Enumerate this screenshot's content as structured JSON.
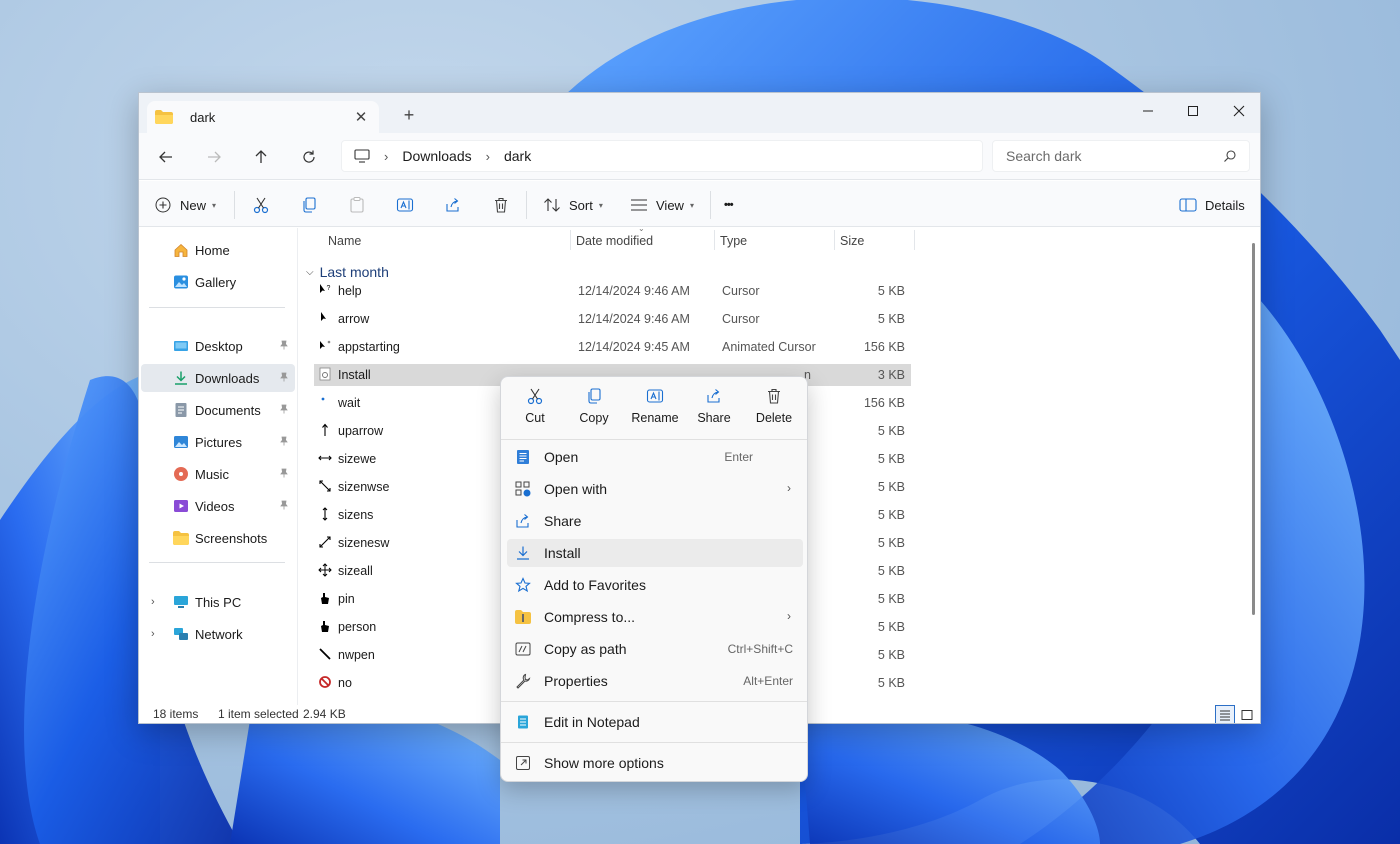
{
  "tab": {
    "title": "dark",
    "close_glyph": "✕",
    "new_tab_glyph": "+"
  },
  "window_controls": {
    "minimize": "—",
    "maximize": "☐",
    "close": "✕"
  },
  "address": {
    "segments": [
      "Downloads",
      "dark"
    ],
    "separator": "›"
  },
  "search": {
    "placeholder": "Search dark"
  },
  "toolbar": {
    "new_label": "New",
    "sort_label": "Sort",
    "view_label": "View",
    "more_glyph": "•••",
    "details_label": "Details",
    "caret": "▾"
  },
  "sidebar": {
    "top": [
      {
        "label": "Home",
        "icon": "home-icon"
      },
      {
        "label": "Gallery",
        "icon": "gallery-icon"
      }
    ],
    "pinned": [
      {
        "label": "Desktop",
        "icon": "desktop-icon",
        "pinned": true
      },
      {
        "label": "Downloads",
        "icon": "downloads-icon",
        "pinned": true,
        "selected": true
      },
      {
        "label": "Documents",
        "icon": "documents-icon",
        "pinned": true
      },
      {
        "label": "Pictures",
        "icon": "pictures-icon",
        "pinned": true
      },
      {
        "label": "Music",
        "icon": "music-icon",
        "pinned": true
      },
      {
        "label": "Videos",
        "icon": "videos-icon",
        "pinned": true
      },
      {
        "label": "Screenshots",
        "icon": "folder-icon",
        "pinned": false
      }
    ],
    "devices": [
      {
        "label": "This PC",
        "icon": "this-pc-icon"
      },
      {
        "label": "Network",
        "icon": "network-icon"
      }
    ],
    "expand_glyph": "›"
  },
  "columns": {
    "name": "Name",
    "date": "Date modified",
    "type": "Type",
    "size": "Size",
    "sort_glyph": "⌄"
  },
  "group": {
    "label": "Last month",
    "chevron": "⌵"
  },
  "files": [
    {
      "name": "help",
      "date": "12/14/2024 9:46 AM",
      "type": "Cursor",
      "size": "5 KB"
    },
    {
      "name": "arrow",
      "date": "12/14/2024 9:46 AM",
      "type": "Cursor",
      "size": "5 KB"
    },
    {
      "name": "appstarting",
      "date": "12/14/2024 9:45 AM",
      "type": "Animated Cursor",
      "size": "156 KB"
    },
    {
      "name": "Install",
      "date": "",
      "type": "n",
      "size": "3 KB",
      "selected": true
    },
    {
      "name": "wait",
      "date": "",
      "type": "r",
      "size": "156 KB"
    },
    {
      "name": "uparrow",
      "date": "",
      "type": "",
      "size": "5 KB"
    },
    {
      "name": "sizewe",
      "date": "",
      "type": "",
      "size": "5 KB"
    },
    {
      "name": "sizenwse",
      "date": "",
      "type": "",
      "size": "5 KB"
    },
    {
      "name": "sizens",
      "date": "",
      "type": "",
      "size": "5 KB"
    },
    {
      "name": "sizenesw",
      "date": "",
      "type": "",
      "size": "5 KB"
    },
    {
      "name": "sizeall",
      "date": "",
      "type": "",
      "size": "5 KB"
    },
    {
      "name": "pin",
      "date": "",
      "type": "",
      "size": "5 KB"
    },
    {
      "name": "person",
      "date": "",
      "type": "",
      "size": "5 KB"
    },
    {
      "name": "nwpen",
      "date": "",
      "type": "",
      "size": "5 KB"
    },
    {
      "name": "no",
      "date": "",
      "type": "",
      "size": "5 KB"
    }
  ],
  "status": {
    "items": "18 items",
    "selected": "1 item selected",
    "size": "2.94 KB"
  },
  "context_menu": {
    "quick_actions": [
      {
        "label": "Cut",
        "icon": "cut-icon"
      },
      {
        "label": "Copy",
        "icon": "copy-icon"
      },
      {
        "label": "Rename",
        "icon": "rename-icon"
      },
      {
        "label": "Share",
        "icon": "share-icon"
      },
      {
        "label": "Delete",
        "icon": "delete-icon"
      }
    ],
    "items": [
      {
        "label": "Open",
        "accel": "Enter",
        "icon": "open-icon"
      },
      {
        "label": "Open with",
        "submenu": true,
        "icon": "open-with-icon"
      },
      {
        "label": "Share",
        "icon": "share-icon"
      },
      {
        "label": "Install",
        "icon": "install-icon",
        "hover": true
      },
      {
        "label": "Add to Favorites",
        "icon": "star-icon"
      },
      {
        "label": "Compress to...",
        "submenu": true,
        "icon": "compress-icon"
      },
      {
        "label": "Copy as path",
        "accel": "Ctrl+Shift+C",
        "icon": "copy-path-icon"
      },
      {
        "label": "Properties",
        "accel": "Alt+Enter",
        "icon": "properties-icon"
      }
    ],
    "extra": [
      {
        "label": "Edit in Notepad",
        "icon": "notepad-icon"
      },
      {
        "label": "Show more options",
        "icon": "more-options-icon"
      }
    ],
    "submenu_glyph": "›"
  },
  "colors": {
    "accent": "#0067c0",
    "selection": "#d9d9d9",
    "group_header": "#1e3f79",
    "wallpaper_blue": "#1d5fe0"
  }
}
